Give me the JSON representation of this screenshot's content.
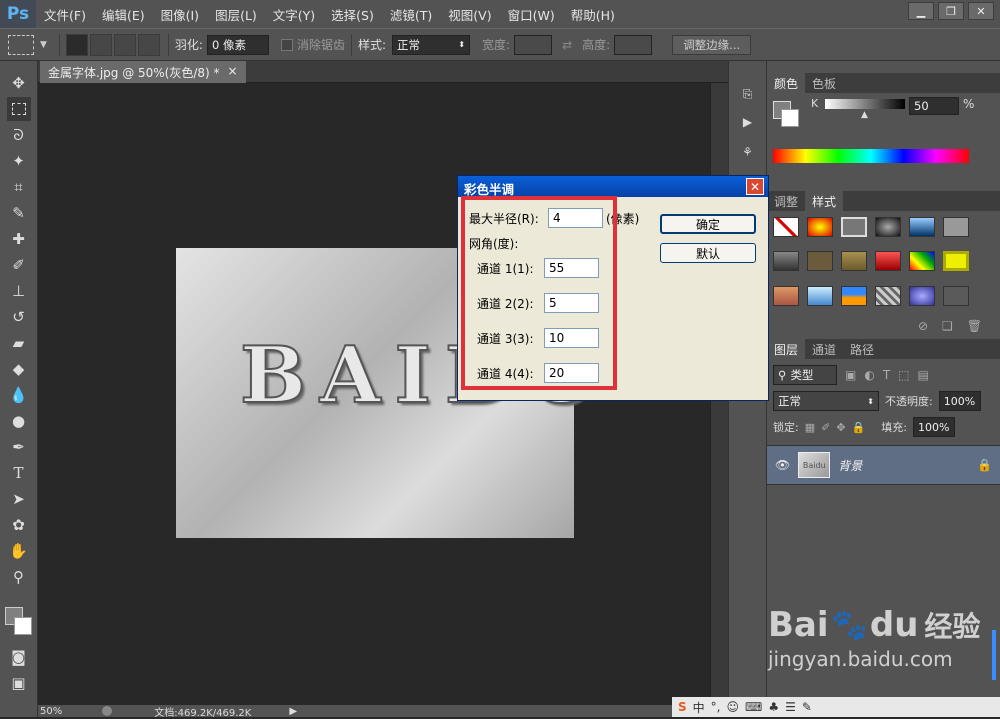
{
  "app": {
    "logo": "Ps"
  },
  "menu": [
    "文件(F)",
    "编辑(E)",
    "图像(I)",
    "图层(L)",
    "文字(Y)",
    "选择(S)",
    "滤镜(T)",
    "视图(V)",
    "窗口(W)",
    "帮助(H)"
  ],
  "window_controls": {
    "minimize": "▁",
    "restore": "❐",
    "close": "✕"
  },
  "options": {
    "feather_label": "羽化:",
    "feather_value": "0 像素",
    "antialias_label": "消除锯齿",
    "style_label": "样式:",
    "style_value": "正常",
    "width_label": "宽度:",
    "height_label": "高度:",
    "refine_edge": "调整边缘..."
  },
  "document": {
    "tab_title": "金属字体.jpg @ 50%(灰色/8) *",
    "tab_close": "×",
    "image_text": "BAIDU"
  },
  "status": {
    "zoom": "50%",
    "doc_info": "文档:469.2K/469.2K"
  },
  "color_panel": {
    "tabs": [
      "颜色",
      "色板"
    ],
    "channel_label": "K",
    "value": "50",
    "unit": "%"
  },
  "styles_panel": {
    "tabs": [
      "调整",
      "样式"
    ]
  },
  "layers_panel": {
    "tabs": [
      "图层",
      "通道",
      "路径"
    ],
    "kind_label": "类型",
    "blend_mode": "正常",
    "opacity_label": "不透明度:",
    "opacity_value": "100%",
    "lock_label": "锁定:",
    "fill_label": "填充:",
    "fill_value": "100%",
    "layer_name": "背景",
    "thumb_text": "Baidu"
  },
  "dialog": {
    "title": "彩色半调",
    "close": "✕",
    "max_radius_label": "最大半径(R):",
    "max_radius_value": "4",
    "unit": "(像素)",
    "angle_label": "网角(度):",
    "channels": [
      {
        "label": "通道 1(1):",
        "value": "55"
      },
      {
        "label": "通道 2(2):",
        "value": "5"
      },
      {
        "label": "通道 3(3):",
        "value": "10"
      },
      {
        "label": "通道 4(4):",
        "value": "20"
      }
    ],
    "ok_button": "确定",
    "default_button": "默认"
  },
  "watermark": {
    "brand": "Bai",
    "brand2": "du",
    "cn": "经验",
    "url": "jingyan.baidu.com"
  },
  "taskbar": {
    "ime": "中",
    "items": [
      "°,",
      "☺",
      "⌨",
      "♣",
      "☰",
      "✎"
    ]
  }
}
